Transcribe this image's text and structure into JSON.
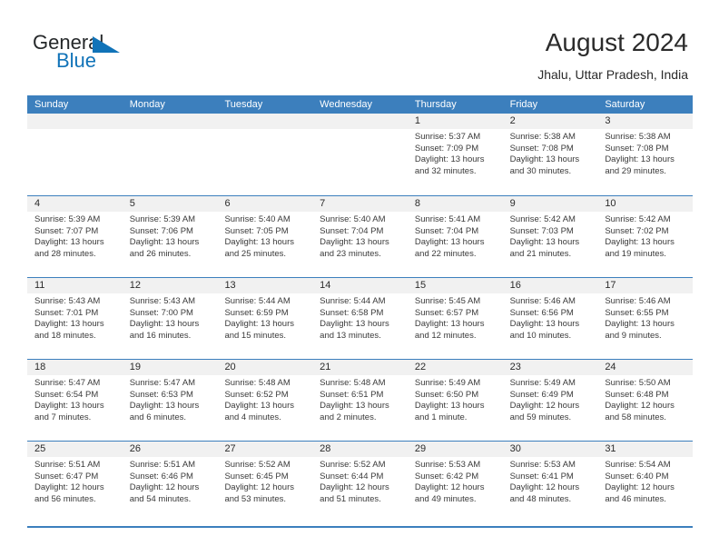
{
  "brand": {
    "name_top": "General",
    "name_bottom": "Blue",
    "accent_color": "#1173b8",
    "triangle_icon": "brand-triangle-icon"
  },
  "header": {
    "title": "August 2024",
    "subtitle": "Jhalu, Uttar Pradesh, India"
  },
  "calendar": {
    "header_color": "#3c7fbd",
    "weekdays": [
      "Sunday",
      "Monday",
      "Tuesday",
      "Wednesday",
      "Thursday",
      "Friday",
      "Saturday"
    ],
    "weeks": [
      [
        {
          "date": "",
          "empty": true
        },
        {
          "date": "",
          "empty": true
        },
        {
          "date": "",
          "empty": true
        },
        {
          "date": "",
          "empty": true
        },
        {
          "date": "1",
          "sunrise": "Sunrise: 5:37 AM",
          "sunset": "Sunset: 7:09 PM",
          "daylight": "Daylight: 13 hours and 32 minutes."
        },
        {
          "date": "2",
          "sunrise": "Sunrise: 5:38 AM",
          "sunset": "Sunset: 7:08 PM",
          "daylight": "Daylight: 13 hours and 30 minutes."
        },
        {
          "date": "3",
          "sunrise": "Sunrise: 5:38 AM",
          "sunset": "Sunset: 7:08 PM",
          "daylight": "Daylight: 13 hours and 29 minutes."
        }
      ],
      [
        {
          "date": "4",
          "sunrise": "Sunrise: 5:39 AM",
          "sunset": "Sunset: 7:07 PM",
          "daylight": "Daylight: 13 hours and 28 minutes."
        },
        {
          "date": "5",
          "sunrise": "Sunrise: 5:39 AM",
          "sunset": "Sunset: 7:06 PM",
          "daylight": "Daylight: 13 hours and 26 minutes."
        },
        {
          "date": "6",
          "sunrise": "Sunrise: 5:40 AM",
          "sunset": "Sunset: 7:05 PM",
          "daylight": "Daylight: 13 hours and 25 minutes."
        },
        {
          "date": "7",
          "sunrise": "Sunrise: 5:40 AM",
          "sunset": "Sunset: 7:04 PM",
          "daylight": "Daylight: 13 hours and 23 minutes."
        },
        {
          "date": "8",
          "sunrise": "Sunrise: 5:41 AM",
          "sunset": "Sunset: 7:04 PM",
          "daylight": "Daylight: 13 hours and 22 minutes."
        },
        {
          "date": "9",
          "sunrise": "Sunrise: 5:42 AM",
          "sunset": "Sunset: 7:03 PM",
          "daylight": "Daylight: 13 hours and 21 minutes."
        },
        {
          "date": "10",
          "sunrise": "Sunrise: 5:42 AM",
          "sunset": "Sunset: 7:02 PM",
          "daylight": "Daylight: 13 hours and 19 minutes."
        }
      ],
      [
        {
          "date": "11",
          "sunrise": "Sunrise: 5:43 AM",
          "sunset": "Sunset: 7:01 PM",
          "daylight": "Daylight: 13 hours and 18 minutes."
        },
        {
          "date": "12",
          "sunrise": "Sunrise: 5:43 AM",
          "sunset": "Sunset: 7:00 PM",
          "daylight": "Daylight: 13 hours and 16 minutes."
        },
        {
          "date": "13",
          "sunrise": "Sunrise: 5:44 AM",
          "sunset": "Sunset: 6:59 PM",
          "daylight": "Daylight: 13 hours and 15 minutes."
        },
        {
          "date": "14",
          "sunrise": "Sunrise: 5:44 AM",
          "sunset": "Sunset: 6:58 PM",
          "daylight": "Daylight: 13 hours and 13 minutes."
        },
        {
          "date": "15",
          "sunrise": "Sunrise: 5:45 AM",
          "sunset": "Sunset: 6:57 PM",
          "daylight": "Daylight: 13 hours and 12 minutes."
        },
        {
          "date": "16",
          "sunrise": "Sunrise: 5:46 AM",
          "sunset": "Sunset: 6:56 PM",
          "daylight": "Daylight: 13 hours and 10 minutes."
        },
        {
          "date": "17",
          "sunrise": "Sunrise: 5:46 AM",
          "sunset": "Sunset: 6:55 PM",
          "daylight": "Daylight: 13 hours and 9 minutes."
        }
      ],
      [
        {
          "date": "18",
          "sunrise": "Sunrise: 5:47 AM",
          "sunset": "Sunset: 6:54 PM",
          "daylight": "Daylight: 13 hours and 7 minutes."
        },
        {
          "date": "19",
          "sunrise": "Sunrise: 5:47 AM",
          "sunset": "Sunset: 6:53 PM",
          "daylight": "Daylight: 13 hours and 6 minutes."
        },
        {
          "date": "20",
          "sunrise": "Sunrise: 5:48 AM",
          "sunset": "Sunset: 6:52 PM",
          "daylight": "Daylight: 13 hours and 4 minutes."
        },
        {
          "date": "21",
          "sunrise": "Sunrise: 5:48 AM",
          "sunset": "Sunset: 6:51 PM",
          "daylight": "Daylight: 13 hours and 2 minutes."
        },
        {
          "date": "22",
          "sunrise": "Sunrise: 5:49 AM",
          "sunset": "Sunset: 6:50 PM",
          "daylight": "Daylight: 13 hours and 1 minute."
        },
        {
          "date": "23",
          "sunrise": "Sunrise: 5:49 AM",
          "sunset": "Sunset: 6:49 PM",
          "daylight": "Daylight: 12 hours and 59 minutes."
        },
        {
          "date": "24",
          "sunrise": "Sunrise: 5:50 AM",
          "sunset": "Sunset: 6:48 PM",
          "daylight": "Daylight: 12 hours and 58 minutes."
        }
      ],
      [
        {
          "date": "25",
          "sunrise": "Sunrise: 5:51 AM",
          "sunset": "Sunset: 6:47 PM",
          "daylight": "Daylight: 12 hours and 56 minutes."
        },
        {
          "date": "26",
          "sunrise": "Sunrise: 5:51 AM",
          "sunset": "Sunset: 6:46 PM",
          "daylight": "Daylight: 12 hours and 54 minutes."
        },
        {
          "date": "27",
          "sunrise": "Sunrise: 5:52 AM",
          "sunset": "Sunset: 6:45 PM",
          "daylight": "Daylight: 12 hours and 53 minutes."
        },
        {
          "date": "28",
          "sunrise": "Sunrise: 5:52 AM",
          "sunset": "Sunset: 6:44 PM",
          "daylight": "Daylight: 12 hours and 51 minutes."
        },
        {
          "date": "29",
          "sunrise": "Sunrise: 5:53 AM",
          "sunset": "Sunset: 6:42 PM",
          "daylight": "Daylight: 12 hours and 49 minutes."
        },
        {
          "date": "30",
          "sunrise": "Sunrise: 5:53 AM",
          "sunset": "Sunset: 6:41 PM",
          "daylight": "Daylight: 12 hours and 48 minutes."
        },
        {
          "date": "31",
          "sunrise": "Sunrise: 5:54 AM",
          "sunset": "Sunset: 6:40 PM",
          "daylight": "Daylight: 12 hours and 46 minutes."
        }
      ]
    ]
  }
}
